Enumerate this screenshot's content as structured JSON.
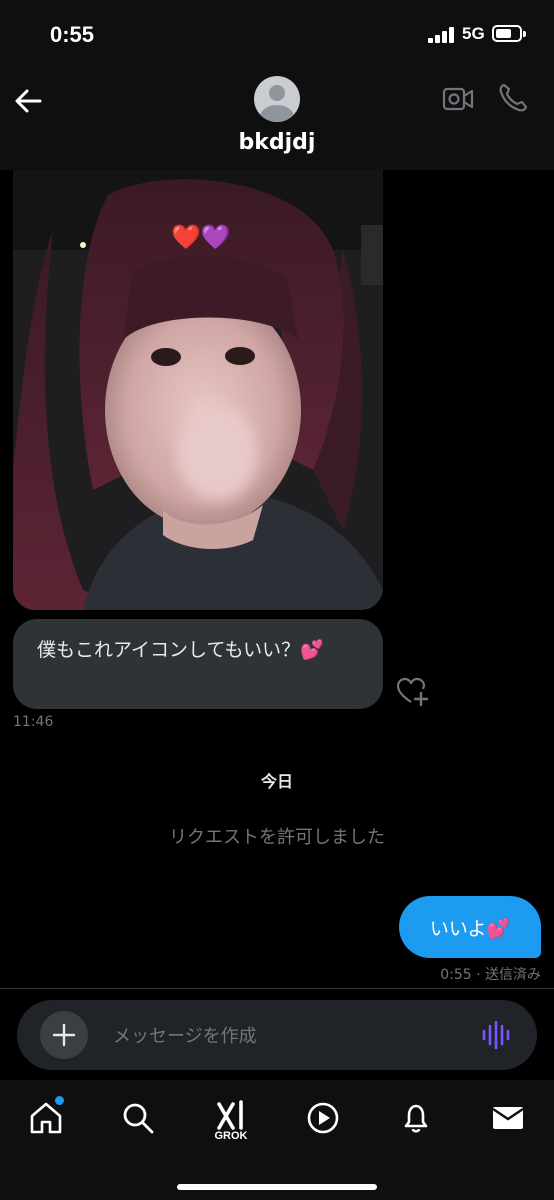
{
  "status_bar": {
    "time": "0:55",
    "network": "5G"
  },
  "header": {
    "contact_name": "bkdjdj"
  },
  "messages": {
    "incoming_text": "僕もこれアイコンしてもいい？💕",
    "incoming_time": "11:46",
    "day_divider": "今日",
    "system_text": "リクエストを許可しました",
    "outgoing_text": "いいよ💕",
    "outgoing_meta": "0:55 · 送信済み",
    "photo_overlay_emoji": "❤️💜"
  },
  "composer": {
    "placeholder": "メッセージを作成"
  },
  "nav": {
    "grok_label": "GROK"
  },
  "colors": {
    "accent": "#1d9bf0",
    "bubble_incoming": "#2f3336",
    "background": "#000000",
    "voice_icon": "#7856ff"
  }
}
